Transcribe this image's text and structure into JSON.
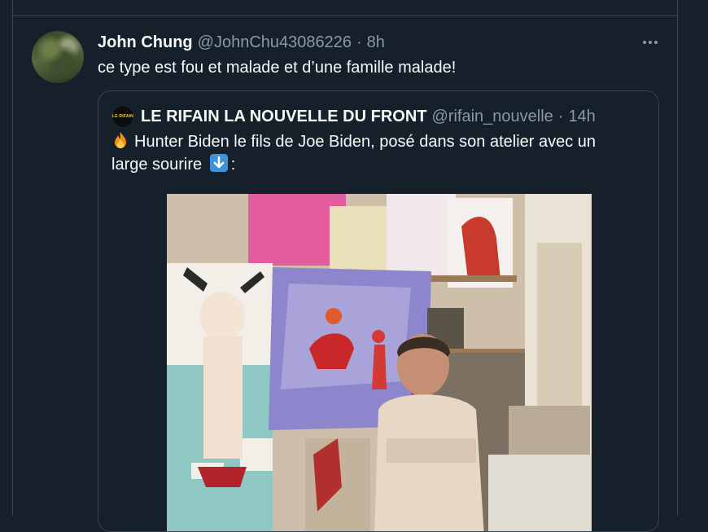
{
  "tweet": {
    "author_name": "John Chung",
    "author_handle": "@JohnChu43086226",
    "separator": "·",
    "time": "8h",
    "text": "ce type est fou et malade et d’une famille malade!"
  },
  "quoted_tweet": {
    "author_name": "LE RIFAIN LA NOUVELLE DU FRONT",
    "author_handle": "@rifain_nouvelle",
    "separator": "·",
    "time": "14h",
    "text_part1": "Hunter Biden le fils de Joe Biden, posé dans son atelier avec un large sourire",
    "text_part2": ":",
    "avatar_logo_text": "LE RIFAIN"
  },
  "icons": {
    "more": "more-horizontal-icon",
    "fire": "fire-emoji-icon",
    "arrow": "down-arrow-emoji-icon"
  },
  "colors": {
    "background": "#15202b",
    "border": "#38444d",
    "text_primary": "#f7f9f9",
    "text_secondary": "#8b98a5",
    "emoji_arrow_bg": "#3b94d9"
  }
}
